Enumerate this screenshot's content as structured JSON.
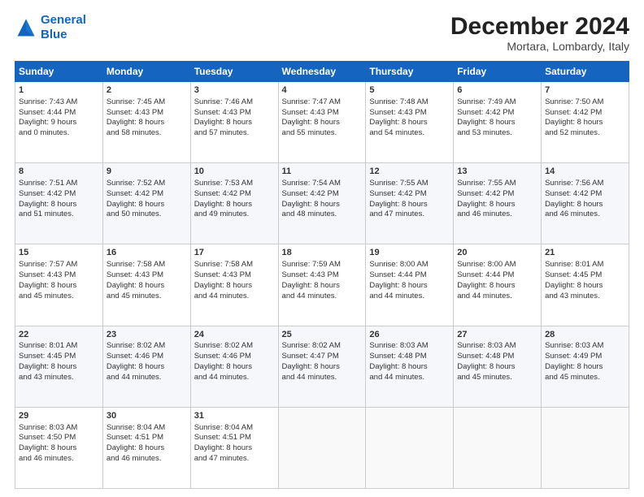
{
  "logo": {
    "line1": "General",
    "line2": "Blue"
  },
  "header": {
    "month": "December 2024",
    "location": "Mortara, Lombardy, Italy"
  },
  "weekdays": [
    "Sunday",
    "Monday",
    "Tuesday",
    "Wednesday",
    "Thursday",
    "Friday",
    "Saturday"
  ],
  "weeks": [
    [
      {
        "day": 1,
        "lines": [
          "Sunrise: 7:43 AM",
          "Sunset: 4:44 PM",
          "Daylight: 9 hours",
          "and 0 minutes."
        ]
      },
      {
        "day": 2,
        "lines": [
          "Sunrise: 7:45 AM",
          "Sunset: 4:43 PM",
          "Daylight: 8 hours",
          "and 58 minutes."
        ]
      },
      {
        "day": 3,
        "lines": [
          "Sunrise: 7:46 AM",
          "Sunset: 4:43 PM",
          "Daylight: 8 hours",
          "and 57 minutes."
        ]
      },
      {
        "day": 4,
        "lines": [
          "Sunrise: 7:47 AM",
          "Sunset: 4:43 PM",
          "Daylight: 8 hours",
          "and 55 minutes."
        ]
      },
      {
        "day": 5,
        "lines": [
          "Sunrise: 7:48 AM",
          "Sunset: 4:43 PM",
          "Daylight: 8 hours",
          "and 54 minutes."
        ]
      },
      {
        "day": 6,
        "lines": [
          "Sunrise: 7:49 AM",
          "Sunset: 4:42 PM",
          "Daylight: 8 hours",
          "and 53 minutes."
        ]
      },
      {
        "day": 7,
        "lines": [
          "Sunrise: 7:50 AM",
          "Sunset: 4:42 PM",
          "Daylight: 8 hours",
          "and 52 minutes."
        ]
      }
    ],
    [
      {
        "day": 8,
        "lines": [
          "Sunrise: 7:51 AM",
          "Sunset: 4:42 PM",
          "Daylight: 8 hours",
          "and 51 minutes."
        ]
      },
      {
        "day": 9,
        "lines": [
          "Sunrise: 7:52 AM",
          "Sunset: 4:42 PM",
          "Daylight: 8 hours",
          "and 50 minutes."
        ]
      },
      {
        "day": 10,
        "lines": [
          "Sunrise: 7:53 AM",
          "Sunset: 4:42 PM",
          "Daylight: 8 hours",
          "and 49 minutes."
        ]
      },
      {
        "day": 11,
        "lines": [
          "Sunrise: 7:54 AM",
          "Sunset: 4:42 PM",
          "Daylight: 8 hours",
          "and 48 minutes."
        ]
      },
      {
        "day": 12,
        "lines": [
          "Sunrise: 7:55 AM",
          "Sunset: 4:42 PM",
          "Daylight: 8 hours",
          "and 47 minutes."
        ]
      },
      {
        "day": 13,
        "lines": [
          "Sunrise: 7:55 AM",
          "Sunset: 4:42 PM",
          "Daylight: 8 hours",
          "and 46 minutes."
        ]
      },
      {
        "day": 14,
        "lines": [
          "Sunrise: 7:56 AM",
          "Sunset: 4:42 PM",
          "Daylight: 8 hours",
          "and 46 minutes."
        ]
      }
    ],
    [
      {
        "day": 15,
        "lines": [
          "Sunrise: 7:57 AM",
          "Sunset: 4:43 PM",
          "Daylight: 8 hours",
          "and 45 minutes."
        ]
      },
      {
        "day": 16,
        "lines": [
          "Sunrise: 7:58 AM",
          "Sunset: 4:43 PM",
          "Daylight: 8 hours",
          "and 45 minutes."
        ]
      },
      {
        "day": 17,
        "lines": [
          "Sunrise: 7:58 AM",
          "Sunset: 4:43 PM",
          "Daylight: 8 hours",
          "and 44 minutes."
        ]
      },
      {
        "day": 18,
        "lines": [
          "Sunrise: 7:59 AM",
          "Sunset: 4:43 PM",
          "Daylight: 8 hours",
          "and 44 minutes."
        ]
      },
      {
        "day": 19,
        "lines": [
          "Sunrise: 8:00 AM",
          "Sunset: 4:44 PM",
          "Daylight: 8 hours",
          "and 44 minutes."
        ]
      },
      {
        "day": 20,
        "lines": [
          "Sunrise: 8:00 AM",
          "Sunset: 4:44 PM",
          "Daylight: 8 hours",
          "and 44 minutes."
        ]
      },
      {
        "day": 21,
        "lines": [
          "Sunrise: 8:01 AM",
          "Sunset: 4:45 PM",
          "Daylight: 8 hours",
          "and 43 minutes."
        ]
      }
    ],
    [
      {
        "day": 22,
        "lines": [
          "Sunrise: 8:01 AM",
          "Sunset: 4:45 PM",
          "Daylight: 8 hours",
          "and 43 minutes."
        ]
      },
      {
        "day": 23,
        "lines": [
          "Sunrise: 8:02 AM",
          "Sunset: 4:46 PM",
          "Daylight: 8 hours",
          "and 44 minutes."
        ]
      },
      {
        "day": 24,
        "lines": [
          "Sunrise: 8:02 AM",
          "Sunset: 4:46 PM",
          "Daylight: 8 hours",
          "and 44 minutes."
        ]
      },
      {
        "day": 25,
        "lines": [
          "Sunrise: 8:02 AM",
          "Sunset: 4:47 PM",
          "Daylight: 8 hours",
          "and 44 minutes."
        ]
      },
      {
        "day": 26,
        "lines": [
          "Sunrise: 8:03 AM",
          "Sunset: 4:48 PM",
          "Daylight: 8 hours",
          "and 44 minutes."
        ]
      },
      {
        "day": 27,
        "lines": [
          "Sunrise: 8:03 AM",
          "Sunset: 4:48 PM",
          "Daylight: 8 hours",
          "and 45 minutes."
        ]
      },
      {
        "day": 28,
        "lines": [
          "Sunrise: 8:03 AM",
          "Sunset: 4:49 PM",
          "Daylight: 8 hours",
          "and 45 minutes."
        ]
      }
    ],
    [
      {
        "day": 29,
        "lines": [
          "Sunrise: 8:03 AM",
          "Sunset: 4:50 PM",
          "Daylight: 8 hours",
          "and 46 minutes."
        ]
      },
      {
        "day": 30,
        "lines": [
          "Sunrise: 8:04 AM",
          "Sunset: 4:51 PM",
          "Daylight: 8 hours",
          "and 46 minutes."
        ]
      },
      {
        "day": 31,
        "lines": [
          "Sunrise: 8:04 AM",
          "Sunset: 4:51 PM",
          "Daylight: 8 hours",
          "and 47 minutes."
        ]
      },
      null,
      null,
      null,
      null
    ]
  ]
}
